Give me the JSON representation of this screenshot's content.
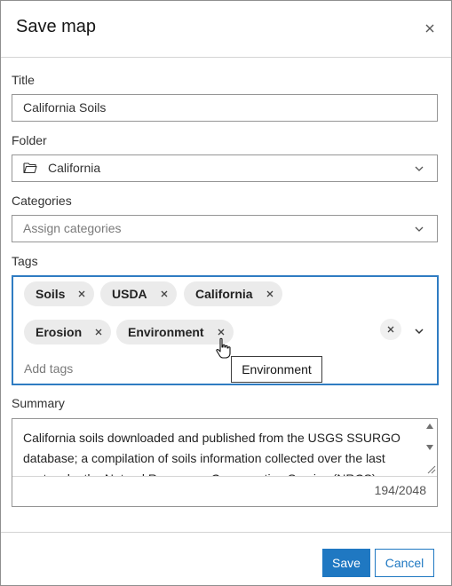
{
  "dialog": {
    "title": "Save map"
  },
  "title_field": {
    "label": "Title",
    "value": "California Soils"
  },
  "folder_field": {
    "label": "Folder",
    "value": "California",
    "icon": "folder-open-icon"
  },
  "categories_field": {
    "label": "Categories",
    "placeholder": "Assign categories"
  },
  "tags_field": {
    "label": "Tags",
    "tags": [
      "Soils",
      "USDA",
      "California",
      "Erosion",
      "Environment"
    ],
    "placeholder": "Add tags",
    "tooltip": "Environment"
  },
  "summary_field": {
    "label": "Summary",
    "value": "California soils downloaded and published from the USGS SSURGO database; a compilation of soils information collected over the last century by the Natural Resources Conservation Service (NRCS).",
    "counter": "194/2048"
  },
  "footer": {
    "save_label": "Save",
    "cancel_label": "Cancel"
  },
  "colors": {
    "accent": "#1f78c2",
    "focus_border": "#2f7cc2",
    "chip_bg": "#ebebeb"
  }
}
